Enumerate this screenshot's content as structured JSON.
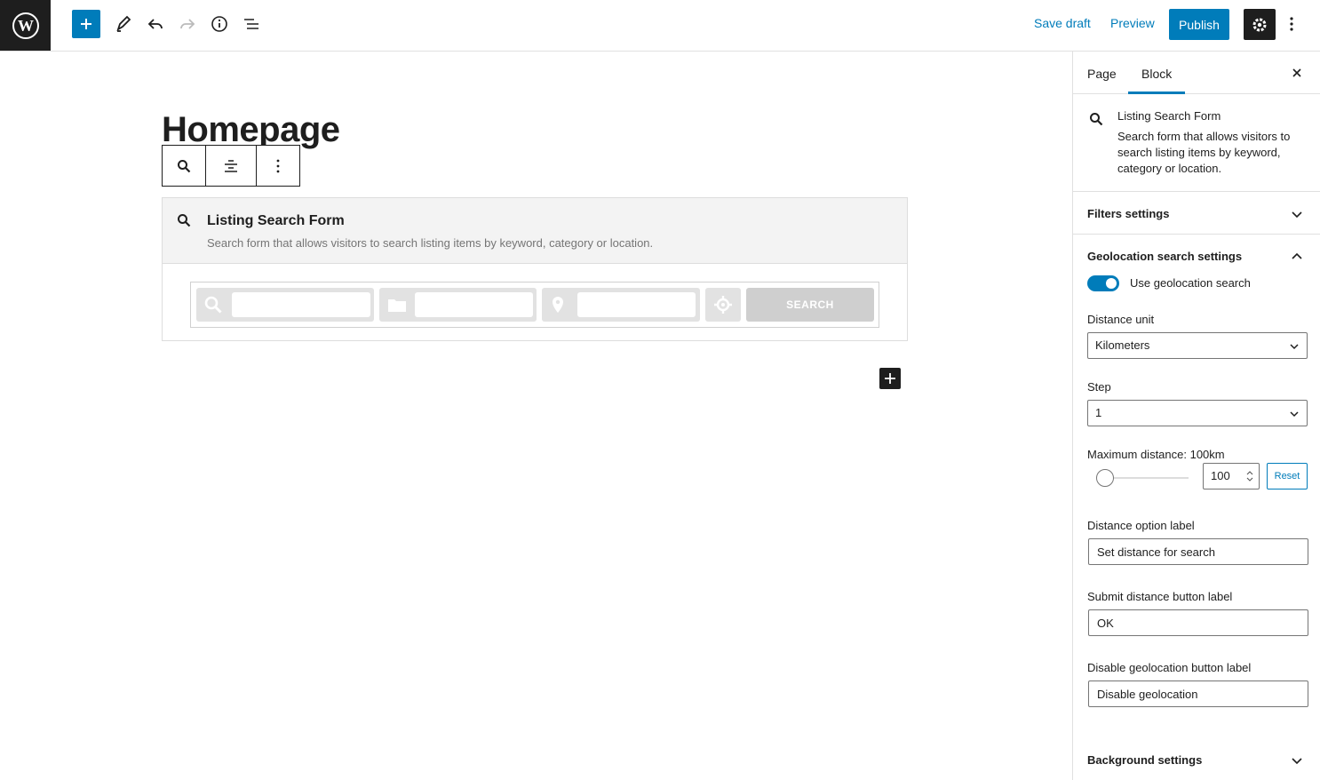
{
  "topbar": {
    "save_draft": "Save draft",
    "preview": "Preview",
    "publish": "Publish"
  },
  "editor": {
    "title": "Homepage",
    "block": {
      "name": "Listing Search Form",
      "description": "Search form that allows visitors to search listing items by keyword, category or location.",
      "submit_label": "SEARCH"
    }
  },
  "sidebar": {
    "tabs": [
      "Page",
      "Block"
    ],
    "active_tab": "Block",
    "block_info": {
      "title": "Listing Search Form",
      "description": "Search form that allows visitors to search listing items by keyword, category or location."
    },
    "panels": {
      "filters": "Filters settings",
      "geolocation": "Geolocation search settings",
      "background": "Background settings"
    },
    "geolocation": {
      "toggle_label": "Use geolocation search",
      "toggle_on": true,
      "distance_unit_label": "Distance unit",
      "distance_unit_value": "Kilometers",
      "step_label": "Step",
      "step_value": "1",
      "max_distance_label": "Maximum distance: 100km",
      "max_distance_value": "100",
      "reset": "Reset",
      "distance_option_label": "Distance option label",
      "distance_option_value": "Set distance for search",
      "submit_distance_label": "Submit distance button label",
      "submit_distance_value": "OK",
      "disable_geo_label": "Disable geolocation button label",
      "disable_geo_value": "Disable geolocation"
    }
  },
  "colors": {
    "accent": "#007cba",
    "dark": "#1e1e1e"
  }
}
